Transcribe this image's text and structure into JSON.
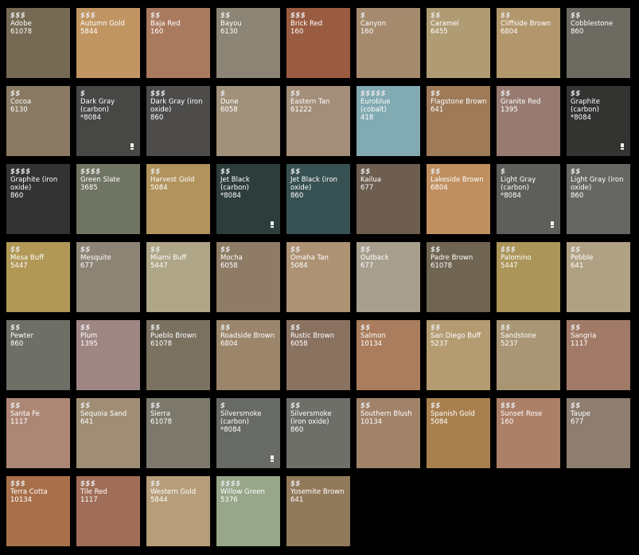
{
  "swatches": [
    {
      "price": "$$$",
      "name": "Adobe",
      "code": "61078",
      "color": "#766a54",
      "warning": false
    },
    {
      "price": "$$$",
      "name": "Autumn Gold",
      "code": "5844",
      "color": "#c19562",
      "warning": false
    },
    {
      "price": "$$",
      "name": "Baja Red",
      "code": "160",
      "color": "#aa7a5f",
      "warning": false
    },
    {
      "price": "$$",
      "name": "Bayou",
      "code": "6130",
      "color": "#8c8474",
      "warning": false
    },
    {
      "price": "$$$",
      "name": "Brick Red",
      "code": "160",
      "color": "#9a5c41",
      "warning": false
    },
    {
      "price": "$",
      "name": "Canyon",
      "code": "160",
      "color": "#a58a6e",
      "warning": false
    },
    {
      "price": "$$",
      "name": "Caramel",
      "code": "6455",
      "color": "#b09c74",
      "warning": false
    },
    {
      "price": "$$",
      "name": "Cliffside Brown",
      "code": "6804",
      "color": "#b2966c",
      "warning": false
    },
    {
      "price": "$$",
      "name": "Cobblestone",
      "code": "860",
      "color": "#6c6a61",
      "warning": false
    },
    {
      "price": "$$",
      "name": "Cocoa",
      "code": "6130",
      "color": "#8a7a63",
      "warning": false
    },
    {
      "price": "$",
      "name": "Dark Gray (carbon)",
      "code": "*8084",
      "color": "#474746",
      "warning": true
    },
    {
      "price": "$$$",
      "name": "Dark Gray (iron oxide)",
      "code": "860",
      "color": "#4d4c4a",
      "warning": false
    },
    {
      "price": "$",
      "name": "Dune",
      "code": "6058",
      "color": "#a1917b",
      "warning": false
    },
    {
      "price": "$$",
      "name": "Eastern Tan",
      "code": "61222",
      "color": "#a38e79",
      "warning": false
    },
    {
      "price": "$$$$$",
      "name": "Euroblue (cobalt)",
      "code": "418",
      "color": "#82aab2",
      "warning": false
    },
    {
      "price": "$$",
      "name": "Flagstone Brown",
      "code": "641",
      "color": "#9e7a58",
      "warning": false
    },
    {
      "price": "$$",
      "name": "Granite Red",
      "code": "1395",
      "color": "#977b70",
      "warning": false
    },
    {
      "price": "$$",
      "name": "Graphite (carbon)",
      "code": "*8084",
      "color": "#333332",
      "warning": true
    },
    {
      "price": "$$$$",
      "name": "Graphite (iron oxide)",
      "code": "860",
      "color": "#343333",
      "warning": false
    },
    {
      "price": "$$$$",
      "name": "Green Slate",
      "code": "3685",
      "color": "#6f7463",
      "warning": false
    },
    {
      "price": "$$",
      "name": "Harvest Gold",
      "code": "5084",
      "color": "#b1935d",
      "warning": false
    },
    {
      "price": "$$",
      "name": "Jet Black (carbon)",
      "code": "*8084",
      "color": "#2d3d3b",
      "warning": true
    },
    {
      "price": "$$",
      "name": "Jet Black (iron oxide)",
      "code": "860",
      "color": "#375152",
      "warning": false
    },
    {
      "price": "$$",
      "name": "Kailua",
      "code": "677",
      "color": "#6d5e50",
      "warning": false
    },
    {
      "price": "$$",
      "name": "Lakeside Brown",
      "code": "6804",
      "color": "#bf8f60",
      "warning": false
    },
    {
      "price": "$",
      "name": "Light Gray (carbon)",
      "code": "*8084",
      "color": "#5e5f5a",
      "warning": true
    },
    {
      "price": "$$",
      "name": "Light Gray (iron oxide)",
      "code": "860",
      "color": "#666762",
      "warning": false
    },
    {
      "price": "$$",
      "name": "Mesa Buff",
      "code": "5447",
      "color": "#b19857",
      "warning": false
    },
    {
      "price": "$$",
      "name": "Mesquite",
      "code": "677",
      "color": "#8e8476",
      "warning": false
    },
    {
      "price": "$$",
      "name": "Miami Buff",
      "code": "5447",
      "color": "#afa687",
      "warning": false
    },
    {
      "price": "$$",
      "name": "Mocha",
      "code": "6058",
      "color": "#8e7c66",
      "warning": false
    },
    {
      "price": "$$",
      "name": "Omaha Tan",
      "code": "5084",
      "color": "#ad9274",
      "warning": false
    },
    {
      "price": "$$",
      "name": "Outback",
      "code": "677",
      "color": "#a79e8e",
      "warning": false
    },
    {
      "price": "$$",
      "name": "Padre Brown",
      "code": "61078",
      "color": "#6f6552",
      "warning": false
    },
    {
      "price": "$$$",
      "name": "Palomino",
      "code": "5447",
      "color": "#ab9559",
      "warning": false
    },
    {
      "price": "$$",
      "name": "Pebble",
      "code": "641",
      "color": "#b1a184",
      "warning": false
    },
    {
      "price": "$$",
      "name": "Pewter",
      "code": "860",
      "color": "#6e6f66",
      "warning": false
    },
    {
      "price": "$$",
      "name": "Plum",
      "code": "1395",
      "color": "#9e8683",
      "warning": false
    },
    {
      "price": "$$",
      "name": "Pueblo Brown",
      "code": "61078",
      "color": "#7a7161",
      "warning": false
    },
    {
      "price": "$$",
      "name": "Roadside Brown",
      "code": "6804",
      "color": "#9b866c",
      "warning": false
    },
    {
      "price": "$$",
      "name": "Rustic Brown",
      "code": "6058",
      "color": "#8a7261",
      "warning": false
    },
    {
      "price": "$$",
      "name": "Salmon",
      "code": "10134",
      "color": "#a97d5d",
      "warning": false
    },
    {
      "price": "$$",
      "name": "San Diego Buff",
      "code": "5237",
      "color": "#b49b72",
      "warning": false
    },
    {
      "price": "$$",
      "name": "Sandstone",
      "code": "5237",
      "color": "#a99674",
      "warning": false
    },
    {
      "price": "$$",
      "name": "Sangria",
      "code": "1117",
      "color": "#a27b68",
      "warning": false
    },
    {
      "price": "$$",
      "name": "Santa Fe",
      "code": "1117",
      "color": "#ad8775",
      "warning": false
    },
    {
      "price": "$$",
      "name": "Sequoia Sand",
      "code": "641",
      "color": "#9f8e74",
      "warning": false
    },
    {
      "price": "$$",
      "name": "Sierra",
      "code": "61078",
      "color": "#7c786b",
      "warning": false
    },
    {
      "price": "$",
      "name": "Silversmoke (carbon)",
      "code": "*8084",
      "color": "#686a66",
      "warning": true
    },
    {
      "price": "$$",
      "name": "Silversmoke (iron oxide)",
      "code": "860",
      "color": "#6e6f69",
      "warning": false
    },
    {
      "price": "$$",
      "name": "Southern Blush",
      "code": "10134",
      "color": "#a08369",
      "warning": false
    },
    {
      "price": "$$",
      "name": "Spanish Gold",
      "code": "5084",
      "color": "#a8804f",
      "warning": false
    },
    {
      "price": "$$$",
      "name": "Sunset Rose",
      "code": "160",
      "color": "#ac7f67",
      "warning": false
    },
    {
      "price": "$$",
      "name": "Taupe",
      "code": "677",
      "color": "#8d7e6f",
      "warning": false
    },
    {
      "price": "$$$",
      "name": "Terra Cotta",
      "code": "10134",
      "color": "#a8704a",
      "warning": false
    },
    {
      "price": "$$$",
      "name": "Tile Red",
      "code": "1117",
      "color": "#a06e58",
      "warning": false
    },
    {
      "price": "$$",
      "name": "Western Gold",
      "code": "5844",
      "color": "#b69e7a",
      "warning": false
    },
    {
      "price": "$$$$",
      "name": "Willow Green",
      "code": "5376",
      "color": "#98a68a",
      "warning": false
    },
    {
      "price": "$$",
      "name": "Yosemite Brown",
      "code": "641",
      "color": "#917a5b",
      "warning": false
    }
  ],
  "icons": {
    "warning": "exclamation-icon"
  }
}
